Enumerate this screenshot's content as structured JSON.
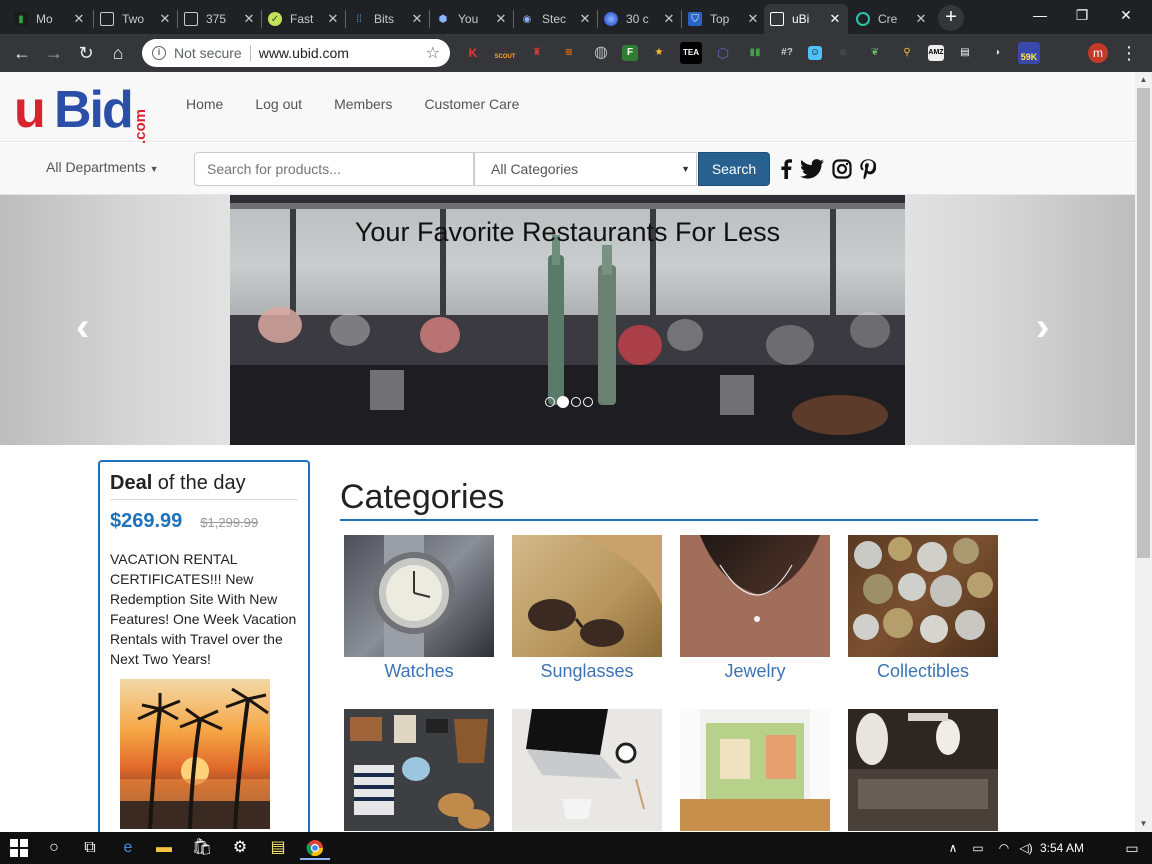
{
  "browser": {
    "tabs": [
      {
        "title": "Mo",
        "icon": "trading-icon"
      },
      {
        "title": "Two",
        "icon": "page-icon"
      },
      {
        "title": "375",
        "icon": "page-icon"
      },
      {
        "title": "Fast",
        "icon": "fastcash-icon"
      },
      {
        "title": "Bits",
        "icon": "bits-icon"
      },
      {
        "title": "You",
        "icon": "hex-icon"
      },
      {
        "title": "Stec",
        "icon": "steam-icon"
      },
      {
        "title": "30 c",
        "icon": "orb-icon"
      },
      {
        "title": "Top",
        "icon": "shield-icon"
      },
      {
        "title": "uBi",
        "icon": "page-icon"
      },
      {
        "title": "Cre",
        "icon": "circle-icon"
      }
    ],
    "active_tab_index": 9,
    "address": {
      "security": "Not secure",
      "url": "www.ubid.com"
    },
    "extensions": [
      "K",
      "SCOUT",
      "",
      "",
      "",
      "F",
      "",
      "TEA",
      "",
      "",
      "#?",
      "",
      "",
      "",
      "",
      "AMZ",
      "",
      "",
      "59K"
    ],
    "profile_initial": "m"
  },
  "site": {
    "nav": [
      "Home",
      "Log out",
      "Members",
      "Customer Care"
    ],
    "search": {
      "departments": "All Departments",
      "placeholder": "Search for products...",
      "category": "All Categories",
      "button": "Search"
    },
    "carousel": {
      "caption": "Your Favorite Restaurants For Less",
      "indicators": 4,
      "active_indicator": 1
    },
    "deal": {
      "title_bold": "Deal",
      "title_rest": " of the day",
      "price": "$269.99",
      "old_price": "$1,299.99",
      "description": "VACATION RENTAL CERTIFICATES!!! New Redemption Site With New Features! One Week Vacation Rentals with Travel over the Next Two Years!"
    },
    "categories_heading": "Categories",
    "categories": [
      {
        "label": "Watches"
      },
      {
        "label": "Sunglasses"
      },
      {
        "label": "Jewelry"
      },
      {
        "label": "Collectibles"
      },
      {
        "label": ""
      },
      {
        "label": ""
      },
      {
        "label": ""
      },
      {
        "label": ""
      }
    ]
  },
  "taskbar": {
    "time": "3:54 AM"
  },
  "colors": {
    "accent": "#1e72bb",
    "search_button": "#286090",
    "logo_red": "#d9232e",
    "logo_blue": "#2b4fa6"
  }
}
